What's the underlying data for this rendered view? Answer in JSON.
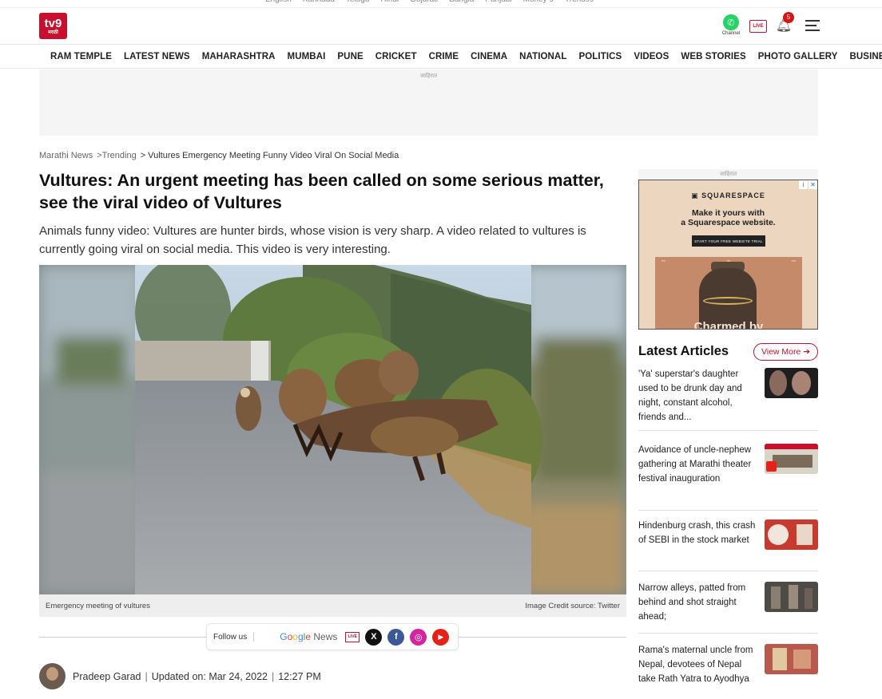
{
  "lang_bar": [
    "English",
    "Kannada",
    "Telugu",
    "Hindi",
    "Gujarati",
    "Bangla",
    "Punjabi",
    "Money 9",
    "Trends9"
  ],
  "logo": {
    "main": "tv9",
    "sub": "मराठी"
  },
  "header": {
    "whatsapp_label": "Channel",
    "live_label": "LIVE",
    "notification_count": "5"
  },
  "nav": {
    "items": [
      "RAM TEMPLE",
      "LATEST NEWS",
      "MAHARASHTRA",
      "MUMBAI",
      "PUNE",
      "CRICKET",
      "CRIME",
      "CINEMA",
      "NATIONAL",
      "POLITICS",
      "VIDEOS",
      "WEB STORIES",
      "PHOTO GALLERY",
      "BUSINESS"
    ]
  },
  "ad_label": "जाहिरात",
  "breadcrumb": {
    "home": "Marathi News",
    "section": ">Trending",
    "current": "> Vultures Emergency Meeting Funny Video Viral On Social Media"
  },
  "article": {
    "headline": "Vultures: An urgent meeting has been called on some serious matter, see the viral video of Vultures",
    "summary": "Animals funny video: Vultures are hunter birds, whose vision is very sharp. A video related to vultures is currently going viral on social media. This video is very interesting.",
    "caption": "Emergency meeting of vultures",
    "credit": "Image Credit source: Twitter",
    "author": "Pradeep Garad",
    "updated": "Updated on: Mar 24, 2022",
    "time": "12:27 PM"
  },
  "follow": {
    "label": "Follow us",
    "google": [
      "G",
      "o",
      "o",
      "g",
      "l",
      "e"
    ],
    "news": " News",
    "live": "LIVE",
    "x": "X",
    "facebook": "f",
    "instagram": "◎",
    "youtube": "▶"
  },
  "sidebar_ad": {
    "brand": "SQUARESPACE",
    "headline_1": "Make it yours with",
    "headline_2": "a Squarespace website.",
    "button": "START YOUR FREE WEBSITE TRIAL",
    "tagline": "Charmed by",
    "info": "i",
    "close": "✕"
  },
  "latest": {
    "title": "Latest Articles",
    "view_more": "View More ➔",
    "items": [
      {
        "text": "'Ya' superstar's daughter used to be drunk day and night, constant alcohol, friends and..."
      },
      {
        "text": "Avoidance of uncle-nephew gathering at Marathi theater festival inauguration"
      },
      {
        "text": "Hindenburg crash, this crash of SEBI in the stock market"
      },
      {
        "text": "Narrow alleys, patted from behind and shot straight ahead;"
      },
      {
        "text": "Rama's maternal uncle from Nepal, devotees of Nepal take Rath Yatra to Ayodhya"
      }
    ]
  },
  "colors": {
    "brand_red": "#c8102e",
    "whatsapp": "#25d366",
    "x": "#111111",
    "facebook": "#3b5998",
    "instagram": "#d6249f",
    "youtube": "#e62117"
  }
}
